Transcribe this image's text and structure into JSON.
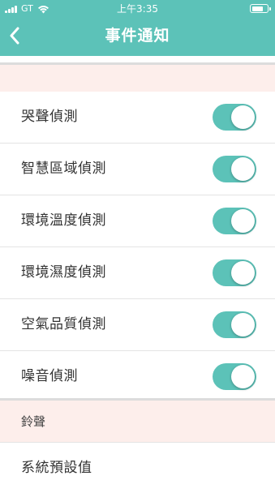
{
  "status_bar": {
    "carrier": "GT",
    "time": "上午3:35",
    "battery_level": 0.8
  },
  "header": {
    "title": "事件通知",
    "back_icon": "chevron-left-icon"
  },
  "detection_settings": [
    {
      "label": "哭聲偵測",
      "enabled": true
    },
    {
      "label": "智慧區域偵測",
      "enabled": true
    },
    {
      "label": "環境溫度偵測",
      "enabled": true
    },
    {
      "label": "環境濕度偵測",
      "enabled": true
    },
    {
      "label": "空氣品質偵測",
      "enabled": true
    },
    {
      "label": "噪音偵測",
      "enabled": true
    }
  ],
  "ringtone_section": {
    "title": "鈴聲",
    "value": "系統預設值"
  },
  "colors": {
    "accent": "#5cc2b8",
    "toggle_on": "#5cc2b8",
    "section_background": "#fdeeeb"
  }
}
